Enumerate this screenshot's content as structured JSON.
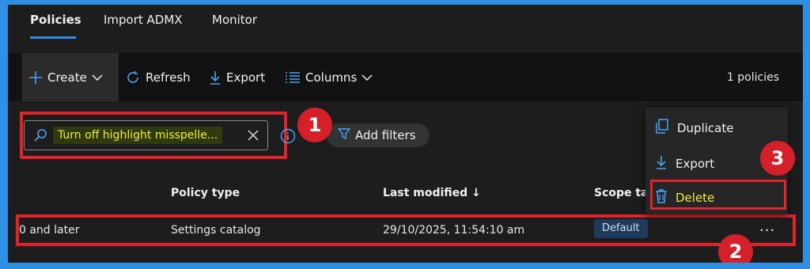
{
  "tabs": [
    {
      "label": "Policies",
      "active": true
    },
    {
      "label": "Import ADMX",
      "active": false
    },
    {
      "label": "Monitor",
      "active": false
    }
  ],
  "toolbar": {
    "create_label": "Create",
    "refresh_label": "Refresh",
    "export_label": "Export",
    "columns_label": "Columns",
    "count_label": "1 policies"
  },
  "search": {
    "value": "Turn off highlight misspelle...",
    "add_filters_label": "Add filters"
  },
  "columns": {
    "policy_type": "Policy type",
    "last_modified": "Last modified ↓",
    "scope_tags": "Scope tag"
  },
  "row": {
    "platform": "0 and later",
    "policy_type": "Settings catalog",
    "last_modified": "29/10/2025, 11:54:10 am",
    "scope_tag": "Default",
    "more": "···"
  },
  "menu": {
    "items": [
      {
        "label": "Duplicate",
        "icon": "duplicate-icon"
      },
      {
        "label": "Export",
        "icon": "download-icon"
      },
      {
        "label": "Delete",
        "icon": "trash-icon"
      }
    ]
  },
  "markers": [
    "1",
    "2",
    "3"
  ],
  "colors": {
    "accent": "#2d8fe5",
    "annotation_red": "#e2232a",
    "highlight_text": "#f4ea39"
  }
}
